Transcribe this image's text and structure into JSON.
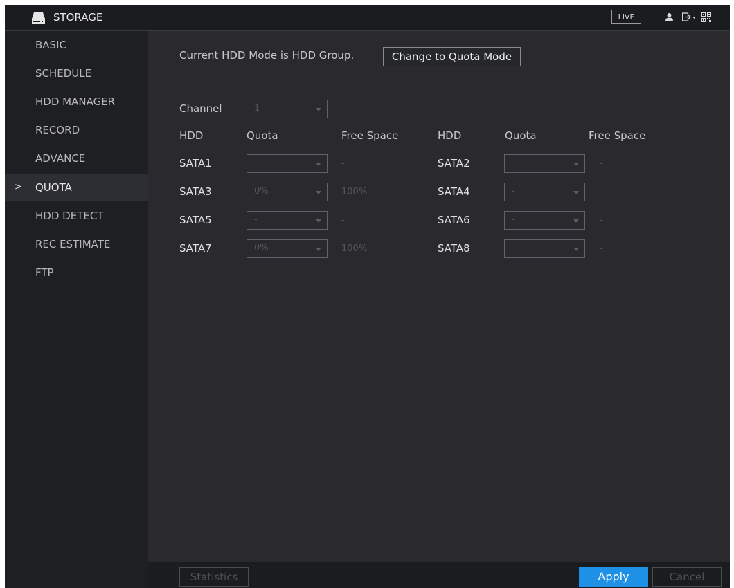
{
  "header": {
    "title": "STORAGE",
    "live_label": "LIVE"
  },
  "sidebar": {
    "items": [
      {
        "label": "BASIC"
      },
      {
        "label": "SCHEDULE"
      },
      {
        "label": "HDD MANAGER"
      },
      {
        "label": "RECORD"
      },
      {
        "label": "ADVANCE"
      },
      {
        "label": "QUOTA",
        "active": true
      },
      {
        "label": "HDD DETECT"
      },
      {
        "label": "REC ESTIMATE"
      },
      {
        "label": "FTP"
      }
    ],
    "active_marker": ">"
  },
  "main": {
    "mode_text": "Current HDD Mode is HDD Group.",
    "change_button": "Change to Quota Mode",
    "channel_label": "Channel",
    "channel_value": "1",
    "columns": {
      "hdd": "HDD",
      "quota": "Quota",
      "free_space": "Free Space"
    },
    "disks": [
      {
        "name": "SATA1",
        "quota": "-",
        "free": "-"
      },
      {
        "name": "SATA2",
        "quota": "-",
        "free": "-"
      },
      {
        "name": "SATA3",
        "quota": "0%",
        "free": "100%"
      },
      {
        "name": "SATA4",
        "quota": "-",
        "free": "-"
      },
      {
        "name": "SATA5",
        "quota": "-",
        "free": "-"
      },
      {
        "name": "SATA6",
        "quota": "-",
        "free": "-"
      },
      {
        "name": "SATA7",
        "quota": "0%",
        "free": "100%"
      },
      {
        "name": "SATA8",
        "quota": "-",
        "free": "-"
      }
    ]
  },
  "footer": {
    "statistics": "Statistics",
    "apply": "Apply",
    "cancel": "Cancel"
  },
  "colors": {
    "accent": "#1e90e6",
    "background": "#2a2a2e",
    "sidebar": "#1e1f23"
  }
}
